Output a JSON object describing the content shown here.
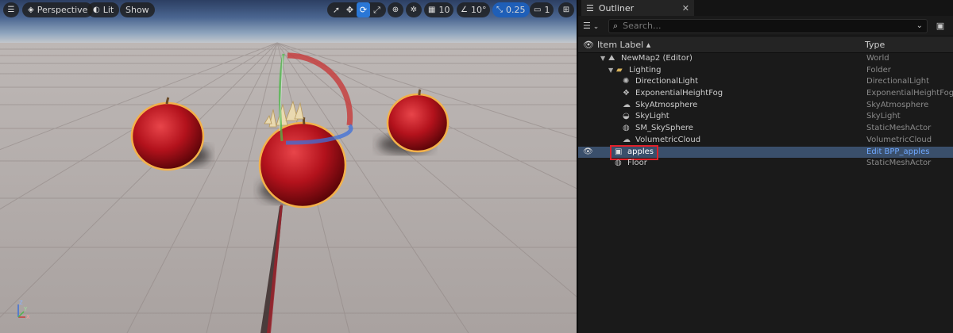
{
  "viewport": {
    "menu_icon": "hamburger-icon",
    "perspective_label": "Perspective",
    "lit_label": "Lit",
    "show_label": "Show",
    "grid_snap_value": "10",
    "rotation_snap_value": "10°",
    "scale_snap_value": "0.25",
    "camera_speed_value": "1",
    "axis_labels": {
      "z": "Z",
      "x": "X",
      "y": "Y"
    }
  },
  "outliner": {
    "tab_title": "Outliner",
    "search_placeholder": "Search...",
    "columns": {
      "label": "Item Label ▴",
      "type": "Type"
    },
    "rows": [
      {
        "label": "NewMap2 (Editor)",
        "type": "World",
        "icon": "world-icon"
      },
      {
        "label": "Lighting",
        "type": "Folder",
        "icon": "folder-icon"
      },
      {
        "label": "DirectionalLight",
        "type": "DirectionalLight",
        "icon": "sun-icon"
      },
      {
        "label": "ExponentialHeightFog",
        "type": "ExponentialHeightFog",
        "icon": "fog-icon"
      },
      {
        "label": "SkyAtmosphere",
        "type": "SkyAtmosphere",
        "icon": "atmosphere-icon"
      },
      {
        "label": "SkyLight",
        "type": "SkyLight",
        "icon": "skylight-icon"
      },
      {
        "label": "SM_SkySphere",
        "type": "StaticMeshActor",
        "icon": "mesh-icon"
      },
      {
        "label": "VolumetricCloud",
        "type": "VolumetricCloud",
        "icon": "cloud-icon"
      },
      {
        "label": "apples",
        "type": "Edit BPP_apples",
        "icon": "blueprint-actor-icon"
      },
      {
        "label": "Floor",
        "type": "StaticMeshActor",
        "icon": "mesh-icon"
      }
    ]
  }
}
